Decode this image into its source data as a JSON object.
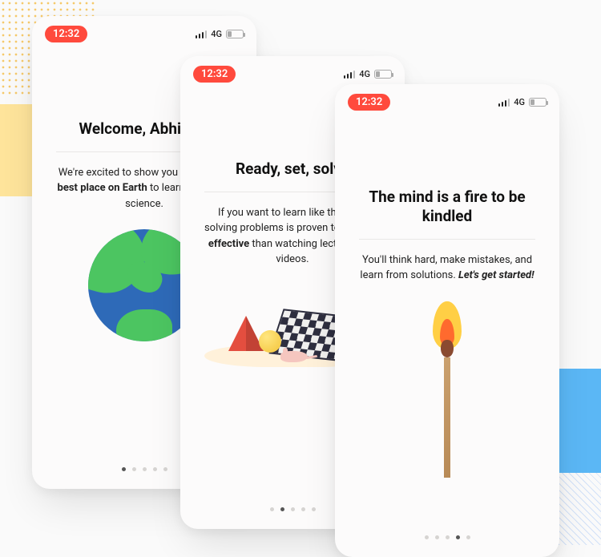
{
  "status": {
    "time": "12:32",
    "network": "4G"
  },
  "screens": [
    {
      "title": "Welcome, Abhinav!",
      "body_pre": "We're excited to show you around the ",
      "body_bold": "best place on Earth",
      "body_post": " to learn math and science.",
      "dots_total": 5,
      "dots_active": 0,
      "art": "globe"
    },
    {
      "title": "Ready, set, solve",
      "body_pre": "If you want to learn like the pros, solving problems is proven to be ",
      "body_bold": "more effective",
      "body_post": " than watching lectures and videos.",
      "dots_total": 5,
      "dots_active": 1,
      "art": "shapes"
    },
    {
      "title": "The mind is a fire to be kindled",
      "body_pre": "You'll think hard, make mistakes, and learn from solutions. ",
      "body_em": "Let's get started!",
      "dots_total": 5,
      "dots_active": 3,
      "art": "match"
    }
  ]
}
